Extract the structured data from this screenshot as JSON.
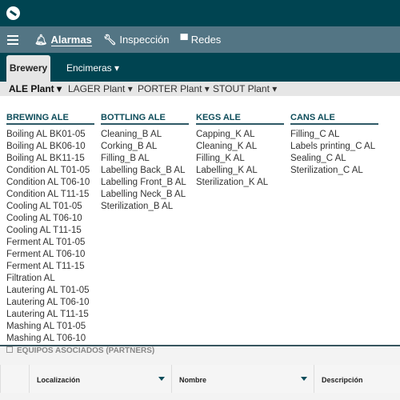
{
  "nav": {
    "items": [
      {
        "label": "Alarmas",
        "icon": "bell-icon"
      },
      {
        "label": "Inspección",
        "icon": "wrench-icon"
      },
      {
        "label": "Redes",
        "icon": "monitor-icon"
      }
    ]
  },
  "tabs": [
    {
      "label": "Brewery ▾"
    },
    {
      "label": "Encimeras ▾"
    }
  ],
  "subnav": [
    {
      "label": "ALE Plant ▾"
    },
    {
      "label": "LAGER Plant ▾"
    },
    {
      "label": "PORTER Plant ▾"
    },
    {
      "label": "STOUT Plant ▾"
    }
  ],
  "menu": [
    {
      "title": "BREWING ALE",
      "items": [
        "Boiling AL BK01-05",
        "Boiling AL BK06-10",
        "Boiling AL BK11-15",
        "Condition AL T01-05",
        "Condition AL T06-10",
        "Condition AL T11-15",
        "Cooling AL T01-05",
        "Cooling AL T06-10",
        "Cooling AL T11-15",
        "Ferment AL T01-05",
        "Ferment AL T06-10",
        "Ferment AL T11-15",
        "Filtration AL",
        "Lautering AL T01-05",
        "Lautering AL T06-10",
        "Lautering AL T11-15",
        "Mashing AL T01-05",
        "Mashing AL T06-10"
      ]
    },
    {
      "title": "BOTTLING ALE",
      "items": [
        "Cleaning_B AL",
        "Corking_B AL",
        "Filling_B AL",
        "Labelling Back_B AL",
        "Labelling Front_B AL",
        "Labelling Neck_B AL",
        "Sterilization_B AL"
      ]
    },
    {
      "title": "KEGS ALE",
      "items": [
        "Capping_K AL",
        "Cleaning_K AL",
        "Filling_K AL",
        "Labelling_K AL",
        "Sterilization_K AL"
      ]
    },
    {
      "title": "CANS ALE",
      "items": [
        "Filling_C AL",
        "Labels printing_C AL",
        "Sealing_C AL",
        "Sterilization_C AL"
      ]
    }
  ],
  "panel": {
    "title": "EQUIPOS ASOCIADOS (PARTNERS)",
    "columns": [
      "Localización",
      "Nombre",
      "Descripción"
    ]
  }
}
